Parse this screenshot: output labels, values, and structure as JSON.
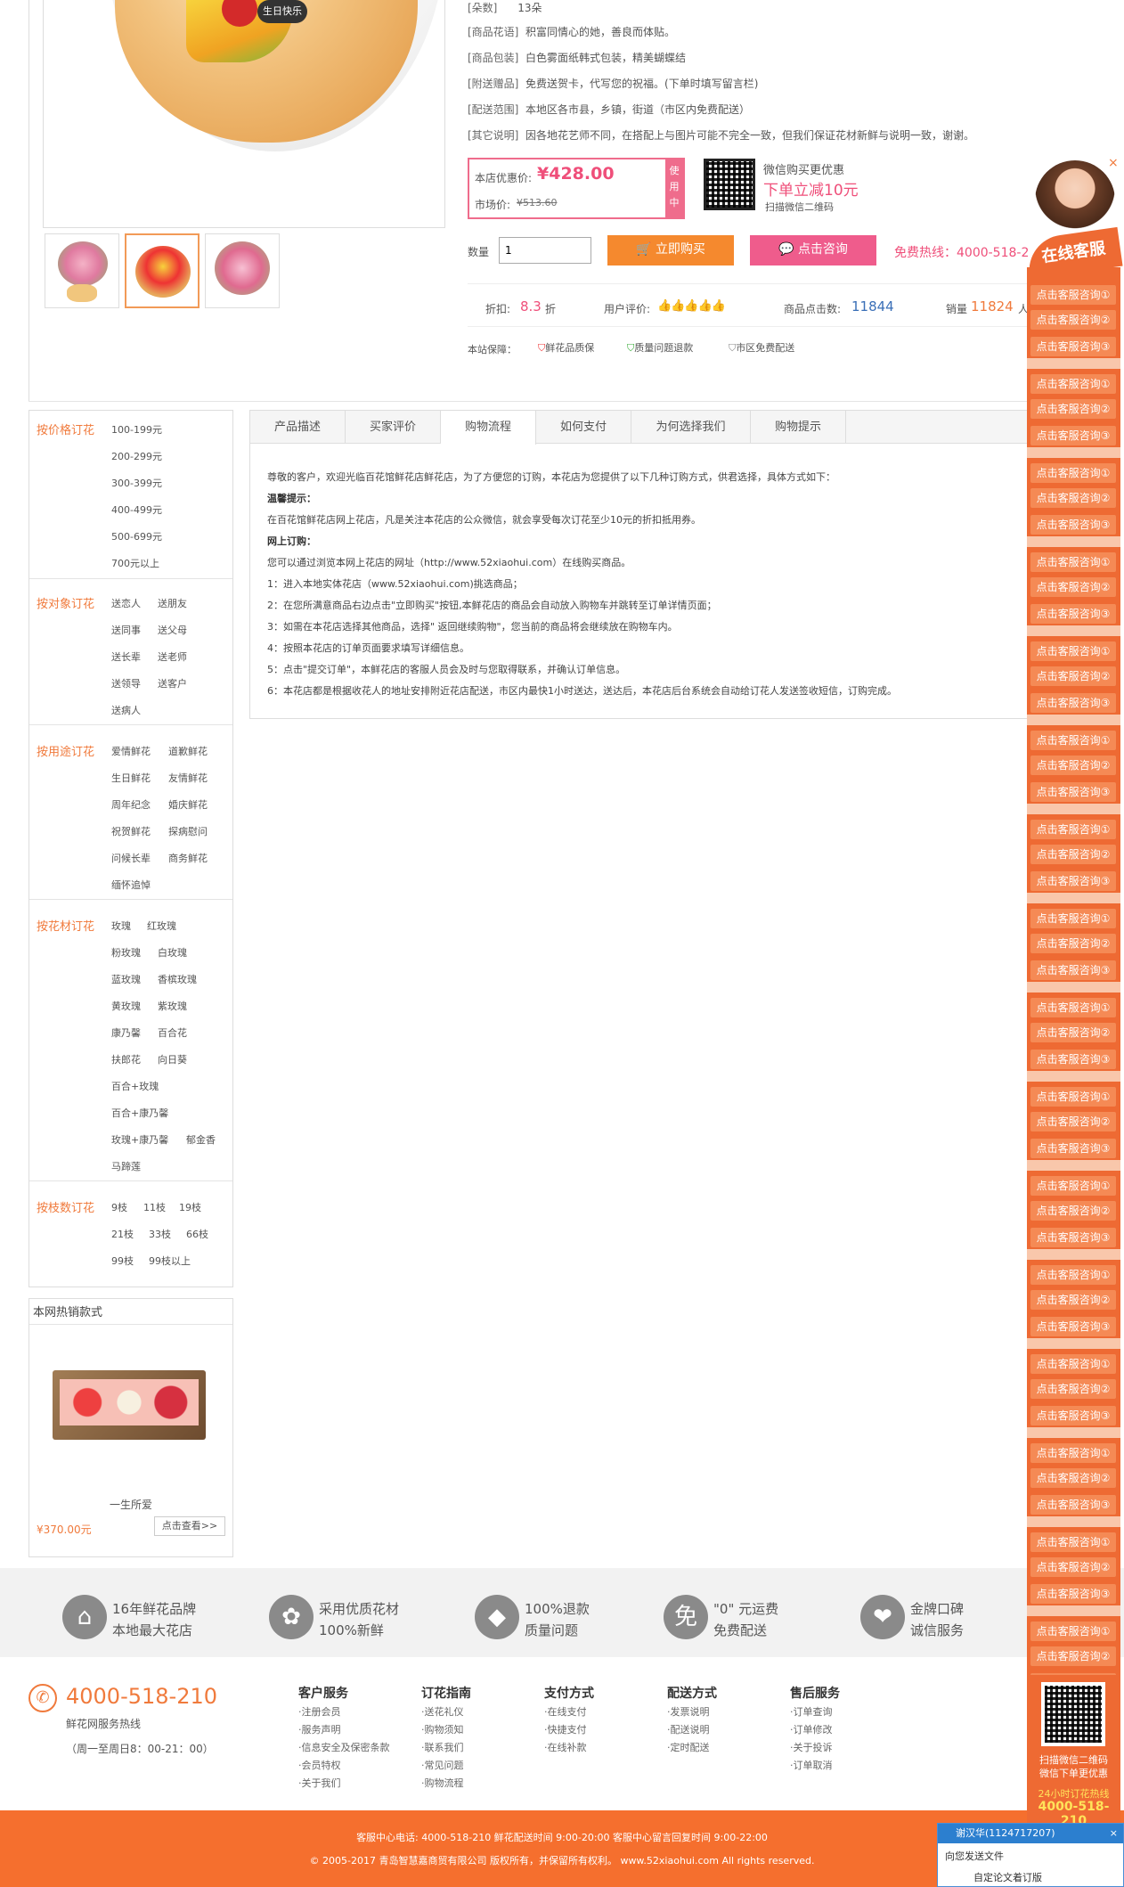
{
  "product": {
    "rows": [
      {
        "label": "[朵数]",
        "value": "13朵"
      },
      {
        "label": "[商品花语]",
        "value": "积富同情心的她，善良而体贴。"
      },
      {
        "label": "[商品包装]",
        "value": "白色雾面纸韩式包装，精美蝴蝶结"
      },
      {
        "label": "[附送赠品]",
        "value": "免费送贺卡，代写您的祝福。(下单时填写留言栏)"
      },
      {
        "label": "[配送范围]",
        "value": "本地区各市县，乡镇，街道（市区内免费配送）"
      },
      {
        "label": "[其它说明]",
        "value": "因各地花艺师不同，在搭配上与图片可能不完全一致，但我们保证花材新鲜与说明一致，谢谢。"
      }
    ],
    "cake_label": "生日快乐",
    "price_label": "本店优惠价:",
    "price": "¥428.00",
    "market_label": "市场价:",
    "market_price": "¥513.60",
    "use_label": "使用中",
    "wechat_title": "微信购买更优惠",
    "wechat_promo": "下单立减10元",
    "wechat_scan": "扫描微信二维码",
    "qty_label": "数量",
    "qty_value": "1",
    "buy_label": "立即购买",
    "consult_label": "点击咨询",
    "hotline": "免费热线：4000-518-2",
    "discount_label": "折扣:",
    "discount_value": "8.3",
    "discount_unit": "折",
    "rating_label": "用户评价:",
    "clicks_label": "商品点击数:",
    "clicks_value": "11844",
    "sales_label": "销量",
    "sales_value": "11824",
    "sales_unit": "人",
    "guarantee_label": "本站保障：",
    "guarantees": [
      "鲜花品质保",
      "质量问题退款",
      "市区免费配送"
    ]
  },
  "tabs": [
    "产品描述",
    "买家评价",
    "购物流程",
    "如何支付",
    "为何选择我们",
    "购物提示"
  ],
  "content": {
    "lines": [
      "尊敬的客户，欢迎光临百花馆鲜花店鲜花店，为了方便您的订购，本花店为您提供了以下几种订购方式，供君选择，具体方式如下：",
      "温馨提示：",
      "在百花馆鲜花店网上花店，凡是关注本花店的公众微信，就会享受每次订花至少10元的折扣抵用券。",
      "网上订购：",
      "您可以通过浏览本网上花店的网址（http://www.52xiaohui.com）在线购买商品。",
      "1：进入本地实体花店（www.52xiaohui.com)挑选商品；",
      "2：在您所满意商品右边点击\"立即购买\"按钮,本鲜花店的商品会自动放入购物车并跳转至订单详情页面；",
      "3：如需在本花店选择其他商品，选择\" 返回继续购物\"，您当前的商品将会继续放在购物车内。",
      "4：按照本花店的订单页面要求填写详细信息。",
      "5：点击\"提交订单\"，本鲜花店的客服人员会及时与您取得联系，并确认订单信息。",
      "6：本花店都是根据收花人的地址安排附近花店配送，市区内最快1小时送达，送达后，本花店后台系统会自动给订花人发送签收短信，订购完成。"
    ]
  },
  "categories": [
    {
      "title": "按价格订花",
      "items": [
        "100-199元",
        "200-299元",
        "300-399元",
        "400-499元",
        "500-699元",
        "700元以上"
      ]
    },
    {
      "title": "按对象订花",
      "items": [
        "送恋人",
        "送朋友",
        "送同事",
        "送父母",
        "送长辈",
        "送老师",
        "送领导",
        "送客户",
        "送病人"
      ]
    },
    {
      "title": "按用途订花",
      "items": [
        "爱情鲜花",
        "道歉鲜花",
        "生日鲜花",
        "友情鲜花",
        "周年纪念",
        "婚庆鲜花",
        "祝贺鲜花",
        "探病慰问",
        "问候长辈",
        "商务鲜花",
        "缅怀追悼"
      ]
    },
    {
      "title": "按花材订花",
      "items": [
        "玫瑰",
        "红玫瑰",
        "粉玫瑰",
        "白玫瑰",
        "蓝玫瑰",
        "香槟玫瑰",
        "黄玫瑰",
        "紫玫瑰",
        "康乃馨",
        "百合花",
        "扶郎花",
        "向日葵",
        "百合+玫瑰",
        "百合+康乃馨",
        "郁金香",
        "玫瑰+康乃馨",
        "马蹄莲"
      ]
    },
    {
      "title": "按枝数订花",
      "items": [
        "9枝",
        "11枝",
        "19枝",
        "21枝",
        "33枝",
        "66枝",
        "99枝",
        "99枝以上"
      ]
    }
  ],
  "hot": {
    "title": "本网热销款式",
    "name": "一生所爱",
    "price": "¥370.00元",
    "btn": "点击查看>>"
  },
  "features": [
    {
      "line1": "16年鲜花品牌",
      "line2": "本地最大花店"
    },
    {
      "line1": "采用优质花材",
      "line2": "100%新鲜"
    },
    {
      "line1": "100%退款",
      "line2": "质量问题"
    },
    {
      "line1": "\"0\" 元运费",
      "line2": "免费配送",
      "icon": "免"
    },
    {
      "line1": "金牌口碑",
      "line2": "诚信服务"
    }
  ],
  "footer": {
    "phone": "4000-518-210",
    "phone_sub": "鲜花网服务热线",
    "hours": "（周一至周日8：00-21：00）",
    "cols": [
      {
        "title": "客户服务",
        "items": [
          "·注册会员",
          "·服务声明",
          "·信息安全及保密条款",
          "·会员特权",
          "·关于我们"
        ]
      },
      {
        "title": "订花指南",
        "items": [
          "·送花礼仪",
          "·购物须知",
          "·联系我们",
          "·常见问题",
          "·购物流程"
        ]
      },
      {
        "title": "支付方式",
        "items": [
          "·在线支付",
          "·快捷支付",
          "·在线补款"
        ]
      },
      {
        "title": "配送方式",
        "items": [
          "·发票说明",
          "·配送说明",
          "·定时配送"
        ]
      },
      {
        "title": "售后服务",
        "items": [
          "·订单查询",
          "·订单修改",
          "·关于投诉",
          "·订单取消"
        ]
      }
    ],
    "bar1": "客服中心电话: 4000-518-210 鲜花配送时间 9:00-20:00 客服中心留言回复时间 9:00-22:00",
    "bar2": "© 2005-2017 青岛智慧嘉商贸有限公司 版权所有，并保留所有权利。 www.52xiaohui.com All rights reserved."
  },
  "online": {
    "title": "在线客服",
    "btn1": "点击客服咨询①",
    "btn2": "点击客服咨询②",
    "btn3": "点击客服咨询③",
    "qr_text1": "扫描微信二维码",
    "qr_text2": "微信下单更优惠",
    "hotline_label": "24小时订花热线",
    "hotline": "4000-518-210"
  },
  "chat": {
    "title": "谢汉华(1124717207)",
    "line1": "向您发送文件",
    "line2": "自定论文着订版"
  }
}
